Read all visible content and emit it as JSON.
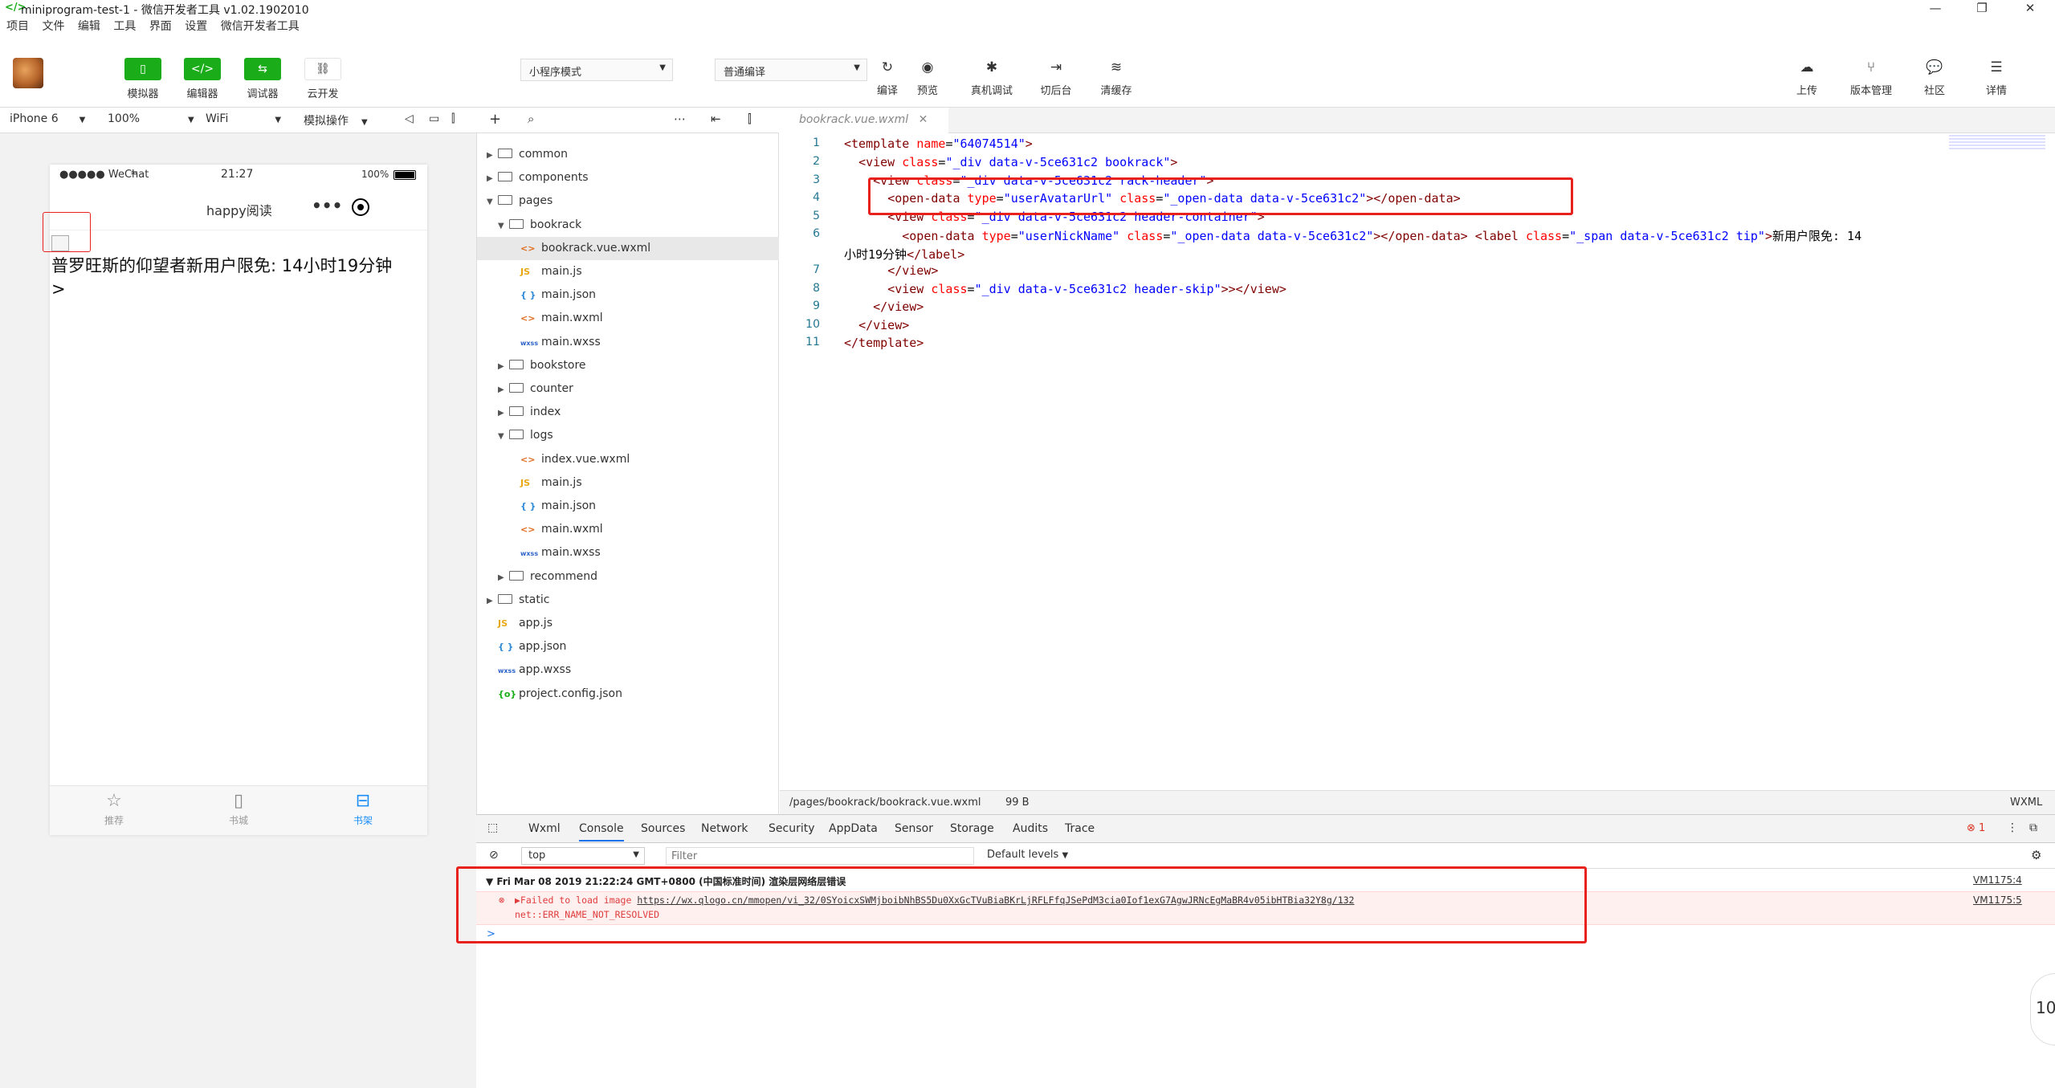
{
  "window": {
    "title": "miniprogram-test-1 - 微信开发者工具 v1.02.1902010",
    "controls": [
      "—",
      "❐",
      "✕"
    ]
  },
  "menu": [
    "项目",
    "文件",
    "编辑",
    "工具",
    "界面",
    "设置",
    "微信开发者工具"
  ],
  "toolbar": {
    "simulator": "模拟器",
    "editor": "编辑器",
    "debugger": "调试器",
    "cloud": "云开发",
    "mode_select": "小程序模式",
    "compile_select": "普通编译",
    "compile": "编译",
    "preview": "预览",
    "remote_debug": "真机调试",
    "background": "切后台",
    "clear_cache": "清缓存",
    "upload": "上传",
    "version": "版本管理",
    "community": "社区",
    "details": "详情"
  },
  "device_bar": {
    "device": "iPhone 6",
    "zoom": "100%",
    "network": "WiFi",
    "simulate": "模拟操作"
  },
  "phone": {
    "carrier": "●●●●● WeChat",
    "time": "21:27",
    "battery": "100%",
    "nav_title": "happy阅读",
    "nav_dots": "•••",
    "content_text": "普罗旺斯的仰望者新用户限免: 14小时19分钟",
    "content_arrow": ">",
    "tabs": [
      {
        "label": "推荐"
      },
      {
        "label": "书城"
      },
      {
        "label": "书架"
      }
    ]
  },
  "file_tree": [
    {
      "name": "common",
      "type": "folder",
      "depth": 0,
      "open": false
    },
    {
      "name": "components",
      "type": "folder",
      "depth": 0,
      "open": false
    },
    {
      "name": "pages",
      "type": "folder",
      "depth": 0,
      "open": true
    },
    {
      "name": "bookrack",
      "type": "folder",
      "depth": 1,
      "open": true
    },
    {
      "name": "bookrack.vue.wxml",
      "type": "wxml",
      "depth": 2,
      "selected": true
    },
    {
      "name": "main.js",
      "type": "js",
      "depth": 2
    },
    {
      "name": "main.json",
      "type": "json",
      "depth": 2
    },
    {
      "name": "main.wxml",
      "type": "wxml",
      "depth": 2
    },
    {
      "name": "main.wxss",
      "type": "wxss",
      "depth": 2
    },
    {
      "name": "bookstore",
      "type": "folder",
      "depth": 1,
      "open": false
    },
    {
      "name": "counter",
      "type": "folder",
      "depth": 1,
      "open": false
    },
    {
      "name": "index",
      "type": "folder",
      "depth": 1,
      "open": false
    },
    {
      "name": "logs",
      "type": "folder",
      "depth": 1,
      "open": true
    },
    {
      "name": "index.vue.wxml",
      "type": "wxml",
      "depth": 2
    },
    {
      "name": "main.js",
      "type": "js",
      "depth": 2
    },
    {
      "name": "main.json",
      "type": "json",
      "depth": 2
    },
    {
      "name": "main.wxml",
      "type": "wxml",
      "depth": 2
    },
    {
      "name": "main.wxss",
      "type": "wxss",
      "depth": 2
    },
    {
      "name": "recommend",
      "type": "folder",
      "depth": 1,
      "open": false
    },
    {
      "name": "static",
      "type": "folder",
      "depth": 0,
      "open": false
    },
    {
      "name": "app.js",
      "type": "js",
      "depth": 0
    },
    {
      "name": "app.json",
      "type": "json",
      "depth": 0
    },
    {
      "name": "app.wxss",
      "type": "wxss",
      "depth": 0
    },
    {
      "name": "project.config.json",
      "type": "cfg",
      "depth": 0
    }
  ],
  "file_icons": {
    "js": "JS",
    "json": "{ }",
    "wxml": "<>",
    "wxss": "wxss",
    "cfg": "{o}"
  },
  "editor": {
    "tab_name": "bookrack.vue.wxml",
    "line_numbers": [
      "1",
      "2",
      "3",
      "4",
      "5",
      "6",
      "",
      "7",
      "8",
      "9",
      "10",
      "11"
    ],
    "status_path": "/pages/bookrack/bookrack.vue.wxml",
    "status_size": "99 B",
    "status_lang": "WXML"
  },
  "devtools": {
    "tabs": [
      "Wxml",
      "Console",
      "Sources",
      "Network",
      "Security",
      "AppData",
      "Sensor",
      "Storage",
      "Audits",
      "Trace"
    ],
    "active_tab": "Console",
    "error_count": "1",
    "context": "top",
    "filter_placeholder": "Filter",
    "levels": "Default levels",
    "group_header": "Fri Mar 08 2019 21:22:24 GMT+0800 (中国标准时间) 渲染层网络层错误",
    "group_source": "VM1175:4",
    "error_prefix": "▶Failed to load image ",
    "error_url": "https://wx.qlogo.cn/mmopen/vi_32/0SYoicxSWMjboibNhBS5Du0XxGcTVuBiaBKrLjRFLFfqJSePdM3cia0Iof1exG7AgwJRNcEgMaBR4v05ibHTBia32Y8g/132",
    "error_line2": "net::ERR_NAME_NOT_RESOLVED",
    "error_source": "VM1175:5",
    "prompt": ">"
  },
  "corner_badge": "10",
  "colors": {
    "accent_green": "#1aad19",
    "highlight_red": "#e8211c",
    "tab_active": "#1a8ef7"
  }
}
